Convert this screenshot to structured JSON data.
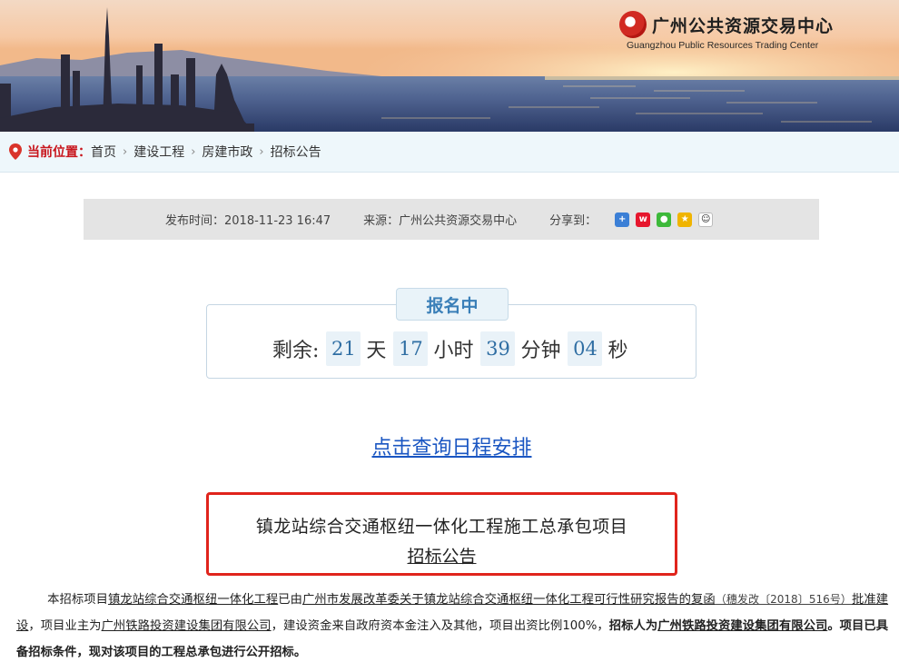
{
  "logo": {
    "name_cn": "广州公共资源交易中心",
    "name_en": "Guangzhou Public Resources Trading Center"
  },
  "breadcrumb": {
    "label": "当前位置：",
    "items": [
      "首页",
      "建设工程",
      "房建市政",
      "招标公告"
    ]
  },
  "meta": {
    "publish_time": "发布时间：2018-11-23 16:47",
    "source": "来源：广州公共资源交易中心",
    "share_label": "分享到：",
    "share_icons": [
      "share-plus-icon",
      "weibo-icon",
      "wechat-icon",
      "qzone-icon",
      "qq-icon"
    ]
  },
  "countdown": {
    "status": "报名中",
    "prefix": "剩余:",
    "days": "21",
    "days_unit": "天",
    "hours": "17",
    "hours_unit": "小时",
    "minutes": "39",
    "minutes_unit": "分钟",
    "seconds": "04",
    "seconds_unit": "秒"
  },
  "schedule_link": "点击查询日程安排",
  "title": {
    "line1": "镇龙站综合交通枢纽一体化工程施工总承包项目",
    "line2": "招标公告"
  },
  "body": {
    "p1_a": "本招标项目",
    "p1_b": "镇龙站综合交通枢纽一体化工程",
    "p1_c": "已由",
    "p1_d": "广州市发展改革委关于镇龙站综合交通枢纽一体化工程可行性研究报告的复函",
    "p1_e": "（穗发改〔2018〕516号）",
    "p1_f": "批准建设",
    "p1_g": "，项目业主为",
    "p1_h": "广州铁路投资建设集团有限公司",
    "p1_i": "，建设资金来自政府资本金注入及其他，项目出资比例100%，",
    "p1_j": "招标人为",
    "p1_k": "广州铁路投资建设集团有限公司",
    "p1_l": "。项目已具备招标条件，现对该项目的工程总承包进行公开招标。"
  },
  "colors": {
    "accent_red": "#e0241c",
    "link_blue": "#1a56c2",
    "countdown_blue": "#3a7fb8",
    "breadcrumb_bg": "#eef7fb",
    "meta_bg": "#e4e4e4"
  }
}
